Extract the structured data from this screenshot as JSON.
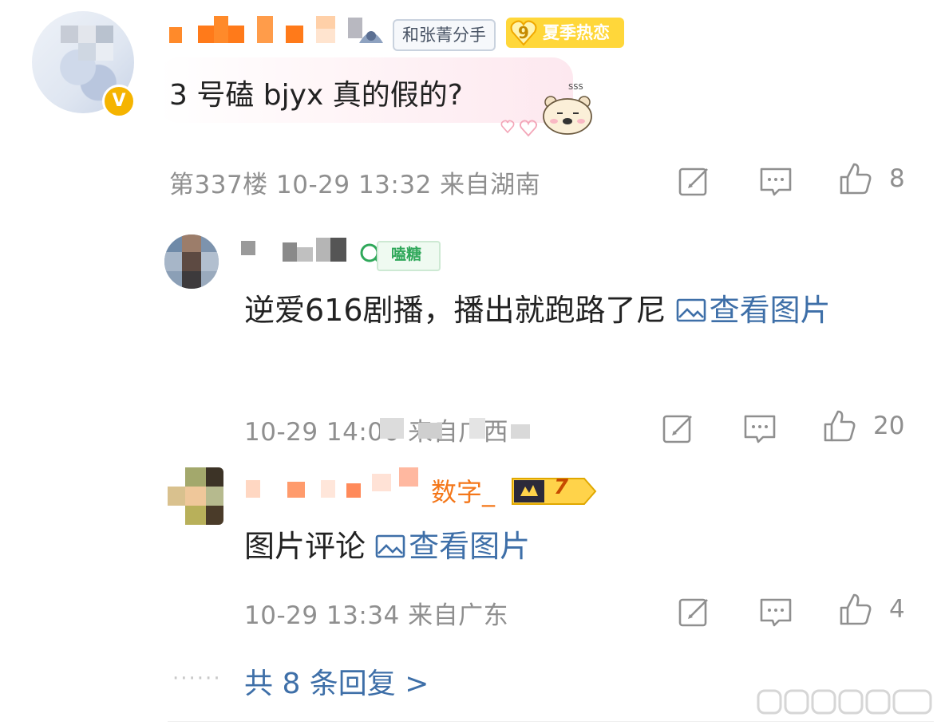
{
  "comment": {
    "fan_tag": "和张菁分手",
    "level_badge": {
      "number": "9",
      "text": "夏季热恋"
    },
    "verified_mark": "V",
    "text": "3 号磕 bjyx 真的假的?",
    "meta": "第337楼 10-29 13:32 来自湖南",
    "likes": "8"
  },
  "replies": [
    {
      "badge": "嗑糖",
      "text": "逆爱616剧播，播出就跑路了尼",
      "link": "查看图片",
      "meta": "10-29 14:06 来自广西",
      "likes": "20"
    },
    {
      "name_partial": "数字_",
      "level": "7",
      "text": "图片评论",
      "link": "查看图片",
      "meta": "10-29 13:34 来自广东",
      "likes": "4"
    }
  ],
  "more_replies": "共 8 条回复 >",
  "dots": "······",
  "icons": [
    "edit-icon",
    "comment-icon",
    "like-icon",
    "image-icon"
  ],
  "colors": {
    "link": "#3e6fa8",
    "meta": "#8f8f8f",
    "level_badge": "#ffd73a",
    "tag_green": "#2fa85a"
  }
}
